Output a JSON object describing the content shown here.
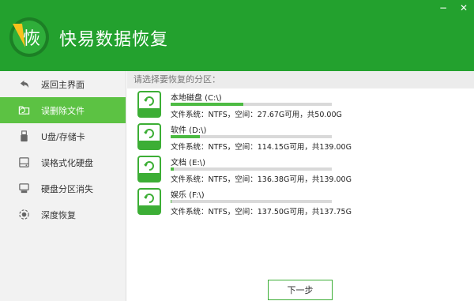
{
  "app": {
    "title": "快易数据恢复",
    "logo_char": "恢"
  },
  "window_controls": {
    "minimize": "−",
    "close": "✕"
  },
  "sidebar": {
    "items": [
      {
        "label": "返回主界面",
        "icon": "back-arrow-icon",
        "active": false
      },
      {
        "label": "误删除文件",
        "icon": "folder-icon",
        "active": true
      },
      {
        "label": "U盘/存储卡",
        "icon": "usb-icon",
        "active": false
      },
      {
        "label": "误格式化硬盘",
        "icon": "hard-drive-icon",
        "active": false
      },
      {
        "label": "硬盘分区消失",
        "icon": "disk-partition-icon",
        "active": false
      },
      {
        "label": "深度恢复",
        "icon": "deep-scan-icon",
        "active": false
      }
    ]
  },
  "main": {
    "prompt": "请选择要恢复的分区：",
    "drives": [
      {
        "name": "本地磁盘 (C:\\)",
        "used_fraction": 0.45,
        "info": "文件系统：NTFS，空间：27.67G可用，共50.00G"
      },
      {
        "name": "软件 (D:\\)",
        "used_fraction": 0.18,
        "info": "文件系统：NTFS，空间：114.15G可用，共139.00G"
      },
      {
        "name": "文档 (E:\\)",
        "used_fraction": 0.02,
        "info": "文件系统：NTFS，空间：136.38G可用，共139.00G"
      },
      {
        "name": "娱乐 (F:\\)",
        "used_fraction": 0.0,
        "info": "文件系统：NTFS，空间：137.50G可用，共137.75G"
      }
    ],
    "next_button": "下一步"
  },
  "colors": {
    "header": "#23a12e",
    "active_item": "#5cc243",
    "bar_fill": "#4dbb43"
  }
}
